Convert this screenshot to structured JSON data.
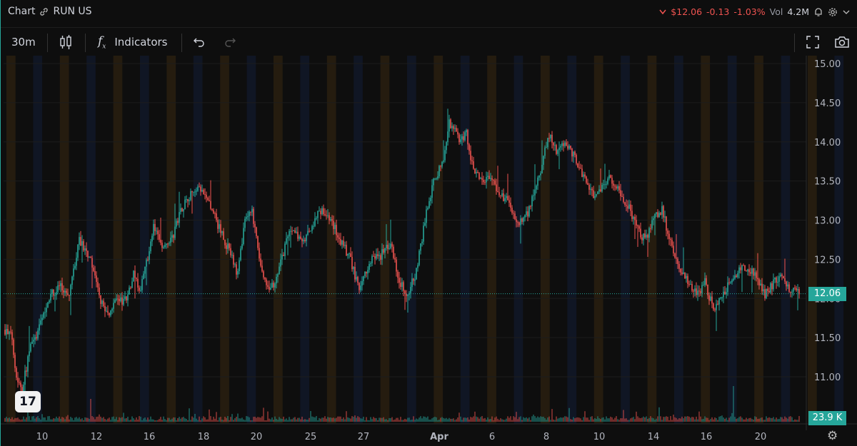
{
  "header": {
    "title": "Chart",
    "symbol": "RUN US",
    "price": "$12.06",
    "change": "-0.13",
    "change_pct": "-1.03%",
    "vol_label": "Vol",
    "vol_value": "4.2M"
  },
  "toolbar": {
    "interval": "30m",
    "indicators_label": "Indicators"
  },
  "colors": {
    "up": "#26a69a",
    "down": "#ef5350",
    "bg": "#0e0e0e",
    "session_orange": "#251c0f",
    "session_blue": "#101624"
  },
  "chart_data": {
    "type": "candlestick",
    "ylim": [
      10.8,
      15.05
    ],
    "y_ticks": [
      "15.00",
      "14.50",
      "14.00",
      "13.50",
      "13.00",
      "12.50",
      "12.00",
      "11.50",
      "11.00"
    ],
    "x_labels": [
      {
        "label": "10",
        "idx": 26
      },
      {
        "label": "12",
        "idx": 64
      },
      {
        "label": "16",
        "idx": 101
      },
      {
        "label": "18",
        "idx": 139
      },
      {
        "label": "20",
        "idx": 176
      },
      {
        "label": "25",
        "idx": 214
      },
      {
        "label": "27",
        "idx": 251
      },
      {
        "label": "Apr",
        "idx": 304
      },
      {
        "label": "6",
        "idx": 341
      },
      {
        "label": "8",
        "idx": 379
      },
      {
        "label": "10",
        "idx": 416
      },
      {
        "label": "14",
        "idx": 454
      },
      {
        "label": "16",
        "idx": 491
      },
      {
        "label": "20",
        "idx": 529
      }
    ],
    "last_price": 12.06,
    "last_price_label": "12.06",
    "volume_label": "23.9 K",
    "price_path": [
      [
        0,
        11.6
      ],
      [
        5,
        11.5
      ],
      [
        8,
        11.0
      ],
      [
        12,
        10.85
      ],
      [
        18,
        11.4
      ],
      [
        22,
        11.5
      ],
      [
        30,
        12.0
      ],
      [
        38,
        12.15
      ],
      [
        45,
        12.05
      ],
      [
        52,
        12.75
      ],
      [
        60,
        12.5
      ],
      [
        66,
        12.0
      ],
      [
        72,
        11.8
      ],
      [
        78,
        11.95
      ],
      [
        85,
        12.0
      ],
      [
        90,
        12.3
      ],
      [
        95,
        12.1
      ],
      [
        104,
        12.9
      ],
      [
        110,
        12.7
      ],
      [
        118,
        12.8
      ],
      [
        122,
        13.1
      ],
      [
        128,
        13.3
      ],
      [
        136,
        13.4
      ],
      [
        143,
        13.2
      ],
      [
        150,
        12.9
      ],
      [
        157,
        12.6
      ],
      [
        163,
        12.3
      ],
      [
        168,
        13.0
      ],
      [
        173,
        13.1
      ],
      [
        178,
        12.5
      ],
      [
        185,
        12.05
      ],
      [
        192,
        12.4
      ],
      [
        200,
        12.9
      ],
      [
        208,
        12.7
      ],
      [
        215,
        12.9
      ],
      [
        220,
        13.15
      ],
      [
        228,
        13.0
      ],
      [
        236,
        12.7
      ],
      [
        242,
        12.5
      ],
      [
        248,
        12.1
      ],
      [
        256,
        12.5
      ],
      [
        263,
        12.55
      ],
      [
        270,
        12.7
      ],
      [
        276,
        12.2
      ],
      [
        282,
        12.05
      ],
      [
        288,
        12.35
      ],
      [
        294,
        13.0
      ],
      [
        300,
        13.5
      ],
      [
        306,
        13.7
      ],
      [
        311,
        14.25
      ],
      [
        318,
        14.05
      ],
      [
        323,
        14.1
      ],
      [
        328,
        13.6
      ],
      [
        334,
        13.5
      ],
      [
        340,
        13.55
      ],
      [
        346,
        13.3
      ],
      [
        352,
        13.25
      ],
      [
        360,
        12.95
      ],
      [
        366,
        13.1
      ],
      [
        372,
        13.45
      ],
      [
        376,
        13.65
      ],
      [
        380,
        14.1
      ],
      [
        386,
        13.9
      ],
      [
        393,
        14.0
      ],
      [
        399,
        13.8
      ],
      [
        406,
        13.5
      ],
      [
        412,
        13.3
      ],
      [
        418,
        13.4
      ],
      [
        424,
        13.55
      ],
      [
        430,
        13.35
      ],
      [
        436,
        13.2
      ],
      [
        442,
        12.9
      ],
      [
        448,
        12.75
      ],
      [
        454,
        13.0
      ],
      [
        460,
        13.15
      ],
      [
        466,
        12.7
      ],
      [
        472,
        12.4
      ],
      [
        478,
        12.2
      ],
      [
        484,
        12.05
      ],
      [
        490,
        12.2
      ],
      [
        496,
        11.85
      ],
      [
        501,
        12.0
      ],
      [
        507,
        12.2
      ],
      [
        514,
        12.35
      ],
      [
        520,
        12.4
      ],
      [
        526,
        12.3
      ],
      [
        532,
        12.05
      ],
      [
        538,
        12.2
      ],
      [
        544,
        12.3
      ],
      [
        550,
        12.1
      ],
      [
        556,
        12.06
      ]
    ],
    "n_bars": 557
  }
}
